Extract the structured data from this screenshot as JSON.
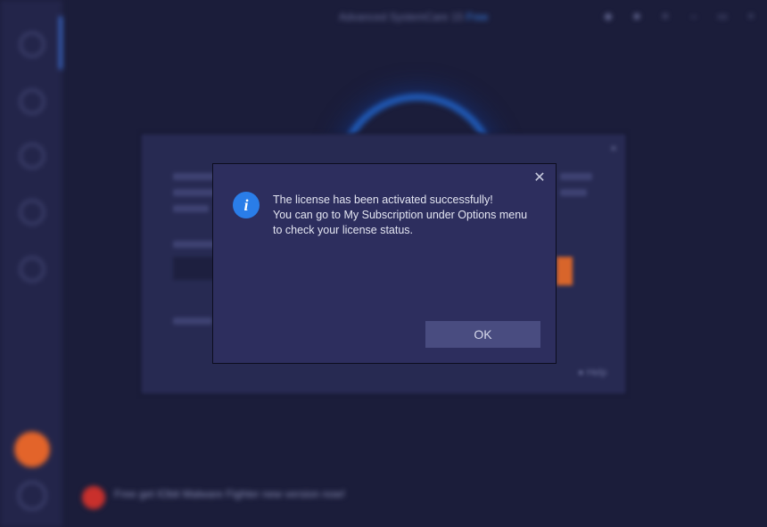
{
  "app": {
    "title": "Advanced SystemCare 15",
    "edition": "Free"
  },
  "background_dialog": {
    "close_glyph": "×",
    "help_label": "Help"
  },
  "promo": {
    "headline": "Free get IObit Malware Fighter new version now!"
  },
  "modal": {
    "close_glyph": "✕",
    "icon_glyph": "i",
    "message_line1": "The license has been activated successfully!",
    "message_line2": "You can go to My Subscription under Options menu",
    "message_line3": "to check your license status.",
    "ok_label": "OK",
    "icon_color": "#2a7de8",
    "background_color": "#2d2e5e"
  }
}
